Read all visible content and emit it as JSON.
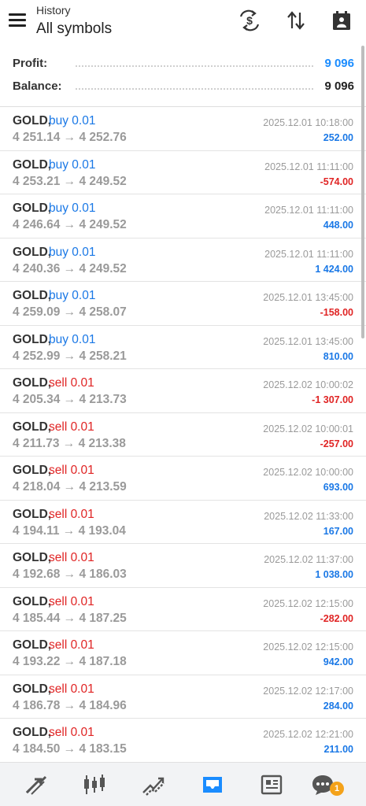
{
  "header": {
    "subtitle": "History",
    "title": "All symbols",
    "icons": [
      "currency-icon",
      "sort-icon",
      "calendar-icon"
    ]
  },
  "summary": {
    "profit_label": "Profit:",
    "profit_value": "9 096",
    "balance_label": "Balance:",
    "balance_value": "9 096"
  },
  "colors": {
    "buy": "#1a78e6",
    "sell": "#e02424",
    "positive": "#1a78e6",
    "negative": "#e02424",
    "accent": "#1a8cff",
    "badge": "#f4a21a"
  },
  "deals": [
    {
      "symbol": "GOLD,",
      "action": "buy 0.01",
      "type": "buy",
      "prices": "4 251.14 → 4 252.76",
      "time": "2025.12.01 10:18:00",
      "profit": "252.00",
      "positive": true
    },
    {
      "symbol": "GOLD,",
      "action": "buy 0.01",
      "type": "buy",
      "prices": "4 253.21 → 4 249.52",
      "time": "2025.12.01 11:11:00",
      "profit": "-574.00",
      "positive": false
    },
    {
      "symbol": "GOLD,",
      "action": "buy 0.01",
      "type": "buy",
      "prices": "4 246.64 → 4 249.52",
      "time": "2025.12.01 11:11:00",
      "profit": "448.00",
      "positive": true
    },
    {
      "symbol": "GOLD,",
      "action": "buy 0.01",
      "type": "buy",
      "prices": "4 240.36 → 4 249.52",
      "time": "2025.12.01 11:11:00",
      "profit": "1 424.00",
      "positive": true
    },
    {
      "symbol": "GOLD,",
      "action": "buy 0.01",
      "type": "buy",
      "prices": "4 259.09 → 4 258.07",
      "time": "2025.12.01 13:45:00",
      "profit": "-158.00",
      "positive": false
    },
    {
      "symbol": "GOLD,",
      "action": "buy 0.01",
      "type": "buy",
      "prices": "4 252.99 → 4 258.21",
      "time": "2025.12.01 13:45:00",
      "profit": "810.00",
      "positive": true
    },
    {
      "symbol": "GOLD,",
      "action": "sell 0.01",
      "type": "sell",
      "prices": "4 205.34 → 4 213.73",
      "time": "2025.12.02 10:00:02",
      "profit": "-1 307.00",
      "positive": false
    },
    {
      "symbol": "GOLD,",
      "action": "sell 0.01",
      "type": "sell",
      "prices": "4 211.73 → 4 213.38",
      "time": "2025.12.02 10:00:01",
      "profit": "-257.00",
      "positive": false
    },
    {
      "symbol": "GOLD,",
      "action": "sell 0.01",
      "type": "sell",
      "prices": "4 218.04 → 4 213.59",
      "time": "2025.12.02 10:00:00",
      "profit": "693.00",
      "positive": true
    },
    {
      "symbol": "GOLD,",
      "action": "sell 0.01",
      "type": "sell",
      "prices": "4 194.11 → 4 193.04",
      "time": "2025.12.02 11:33:00",
      "profit": "167.00",
      "positive": true
    },
    {
      "symbol": "GOLD,",
      "action": "sell 0.01",
      "type": "sell",
      "prices": "4 192.68 → 4 186.03",
      "time": "2025.12.02 11:37:00",
      "profit": "1 038.00",
      "positive": true
    },
    {
      "symbol": "GOLD,",
      "action": "sell 0.01",
      "type": "sell",
      "prices": "4 185.44 → 4 187.25",
      "time": "2025.12.02 12:15:00",
      "profit": "-282.00",
      "positive": false
    },
    {
      "symbol": "GOLD,",
      "action": "sell 0.01",
      "type": "sell",
      "prices": "4 193.22 → 4 187.18",
      "time": "2025.12.02 12:15:00",
      "profit": "942.00",
      "positive": true
    },
    {
      "symbol": "GOLD,",
      "action": "sell 0.01",
      "type": "sell",
      "prices": "4 186.78 → 4 184.96",
      "time": "2025.12.02 12:17:00",
      "profit": "284.00",
      "positive": true
    },
    {
      "symbol": "GOLD,",
      "action": "sell 0.01",
      "type": "sell",
      "prices": "4 184.50 → 4 183.15",
      "time": "2025.12.02 12:21:00",
      "profit": "211.00",
      "positive": true
    }
  ],
  "bottom_nav": {
    "items": [
      "quotes-icon",
      "chart-icon",
      "trade-icon",
      "history-icon",
      "news-icon",
      "chat-icon"
    ],
    "active": "history-icon",
    "chat_badge": "1"
  }
}
